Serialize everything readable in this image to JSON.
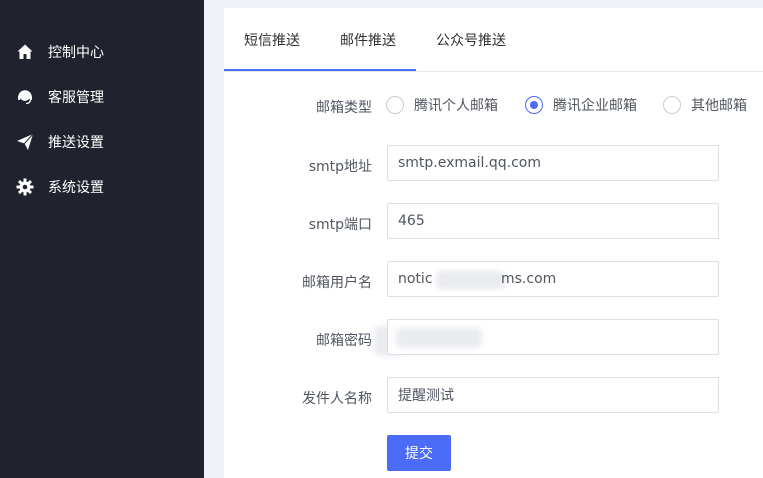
{
  "sidebar": {
    "items": [
      {
        "label": "控制中心",
        "icon": "home-icon"
      },
      {
        "label": "客服管理",
        "icon": "headset-icon"
      },
      {
        "label": "推送设置",
        "icon": "paper-plane-icon"
      },
      {
        "label": "系统设置",
        "icon": "gear-icon"
      }
    ]
  },
  "tabs": [
    {
      "label": "短信推送"
    },
    {
      "label": "邮件推送",
      "active": true
    },
    {
      "label": "公众号推送"
    }
  ],
  "form": {
    "mailbox_type_label": "邮箱类型",
    "mailbox_options": [
      {
        "label": "腾讯个人邮箱",
        "checked": false
      },
      {
        "label": "腾讯企业邮箱",
        "checked": true
      },
      {
        "label": "其他邮箱",
        "checked": false
      }
    ],
    "smtp_address_label": "smtp地址",
    "smtp_address_value": "smtp.exmail.qq.com",
    "smtp_port_label": "smtp端口",
    "smtp_port_value": "465",
    "username_label": "邮箱用户名",
    "username_value_prefix": "notic",
    "username_value_suffix": "ms.com",
    "password_label": "邮箱密码",
    "sender_name_label": "发件人名称",
    "sender_name_value": "提醒测试",
    "submit_label": "提交"
  },
  "colors": {
    "sidebar_bg": "#20232d",
    "accent": "#4a6cf7",
    "page_bg": "#eef1f6"
  }
}
